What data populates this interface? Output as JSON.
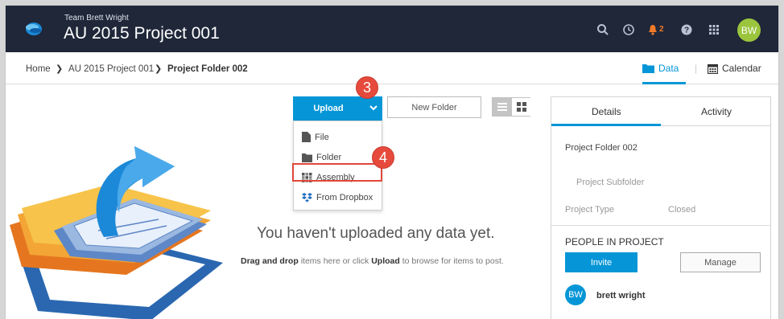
{
  "header": {
    "team_label": "Team Brett Wright",
    "project_title": "AU 2015 Project 001",
    "notification_count": "2",
    "user_initials": "BW"
  },
  "breadcrumb": {
    "items": [
      "Home",
      "AU 2015 Project 001",
      "Project Folder 002"
    ]
  },
  "view_switch": {
    "data_label": "Data",
    "calendar_label": "Calendar"
  },
  "toolbar": {
    "upload_label": "Upload",
    "new_folder_label": "New Folder"
  },
  "upload_menu": {
    "items": [
      "File",
      "Folder",
      "Assembly",
      "From Dropbox"
    ]
  },
  "step_markers": {
    "upload_step": "3",
    "assembly_step": "4"
  },
  "empty_state": {
    "title": "You haven't uploaded any data yet.",
    "drag_drop": "Drag and drop",
    "middle": "items here or click",
    "upload_word": "Upload",
    "end": "to browse for items to post."
  },
  "panel": {
    "tabs": [
      "Details",
      "Activity"
    ],
    "folder_name": "Project Folder 002",
    "subfolder_label": "Project Subfolder",
    "project_type_label": "Project Type",
    "project_type_value": "Closed",
    "people_heading": "PEOPLE IN PROJECT",
    "invite_label": "Invite",
    "manage_label": "Manage",
    "member_initials": "BW",
    "member_name": "brett wright"
  },
  "colors": {
    "accent": "#0696d7",
    "header_bg": "#1f2739",
    "step_badge": "#e64a3c",
    "avatar": "#9bc53d",
    "notification": "#f07a28"
  }
}
